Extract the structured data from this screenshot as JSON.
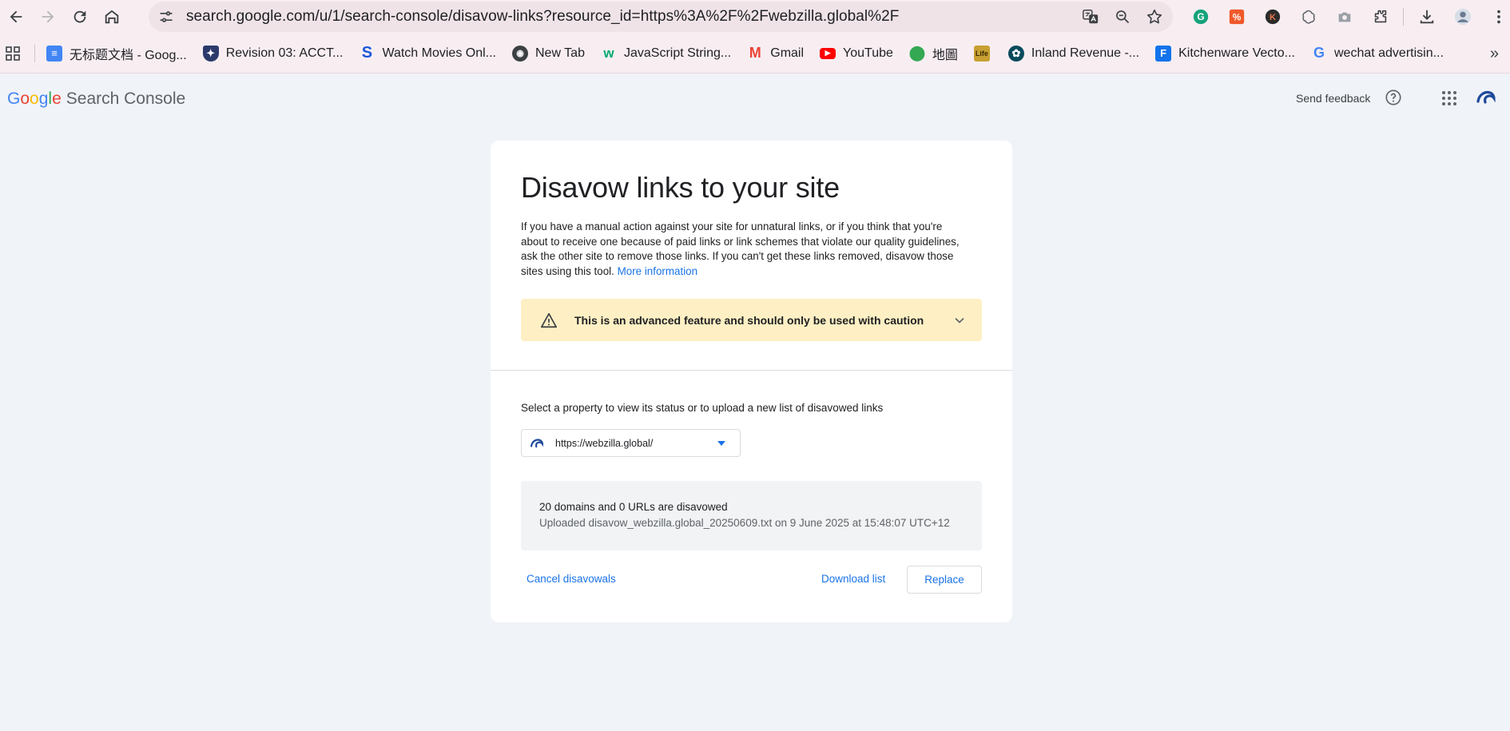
{
  "browser": {
    "url": "search.google.com/u/1/search-console/disavow-links?resource_id=https%3A%2F%2Fwebzilla.global%2F",
    "url_shown": "search.google.com/u/1/search-console/disavow-links?resource_id=https%3A%2F%2Fwebzilla.global%2F",
    "bookmarks": [
      {
        "label": "无标题文档 - Goog...",
        "icon": "google-docs-icon",
        "color": "#4285f4"
      },
      {
        "label": "Revision 03: ACCT...",
        "icon": "university-crest-icon",
        "color": "#2b3a6b"
      },
      {
        "label": "Watch Movies Onl...",
        "icon": "s-logo-icon",
        "color": "#1a56db"
      },
      {
        "label": "New Tab",
        "icon": "globe-icon",
        "color": "#3c4043"
      },
      {
        "label": "JavaScript String...",
        "icon": "w3schools-icon",
        "color": "#04aa6d"
      },
      {
        "label": "Gmail",
        "icon": "gmail-icon",
        "color": "#ea4335"
      },
      {
        "label": "YouTube",
        "icon": "youtube-icon",
        "color": "#ff0000"
      },
      {
        "label": "地圖",
        "icon": "google-maps-icon",
        "color": "#34a853"
      },
      {
        "label": "",
        "icon": "life-icon",
        "color": "#c8a032"
      },
      {
        "label": "Inland Revenue -...",
        "icon": "fern-icon",
        "color": "#0a4a5c"
      },
      {
        "label": "Kitchenware Vecto...",
        "icon": "freepik-icon",
        "color": "#1273eb"
      },
      {
        "label": "wechat advertisin...",
        "icon": "google-g-icon",
        "color": "#4285f4"
      }
    ]
  },
  "header": {
    "logo": {
      "G": "G",
      "o1": "o",
      "o2": "o",
      "g": "g",
      "l": "l",
      "e": "e",
      "product": "Search Console"
    },
    "send_feedback": "Send feedback"
  },
  "card": {
    "title": "Disavow links to your site",
    "description": "If you have a manual action against your site for unnatural links, or if you think that you're about to receive one because of paid links or link schemes that violate our quality guidelines, ask the other site to remove those links. If you can't get these links removed, disavow those sites using this tool.",
    "more_info": "More information",
    "warning": "This is an advanced feature and should only be used with caution",
    "select_label": "Select a property to view its status or to upload a new list of disavowed links",
    "property": "https://webzilla.global/",
    "status_line1": "20 domains and 0 URLs are disavowed",
    "status_line2": "Uploaded disavow_webzilla.global_20250609.txt on 9 June 2025 at 15:48:07 UTC+12",
    "cancel_label": "Cancel disavowals",
    "download_label": "Download list",
    "replace_label": "Replace"
  }
}
